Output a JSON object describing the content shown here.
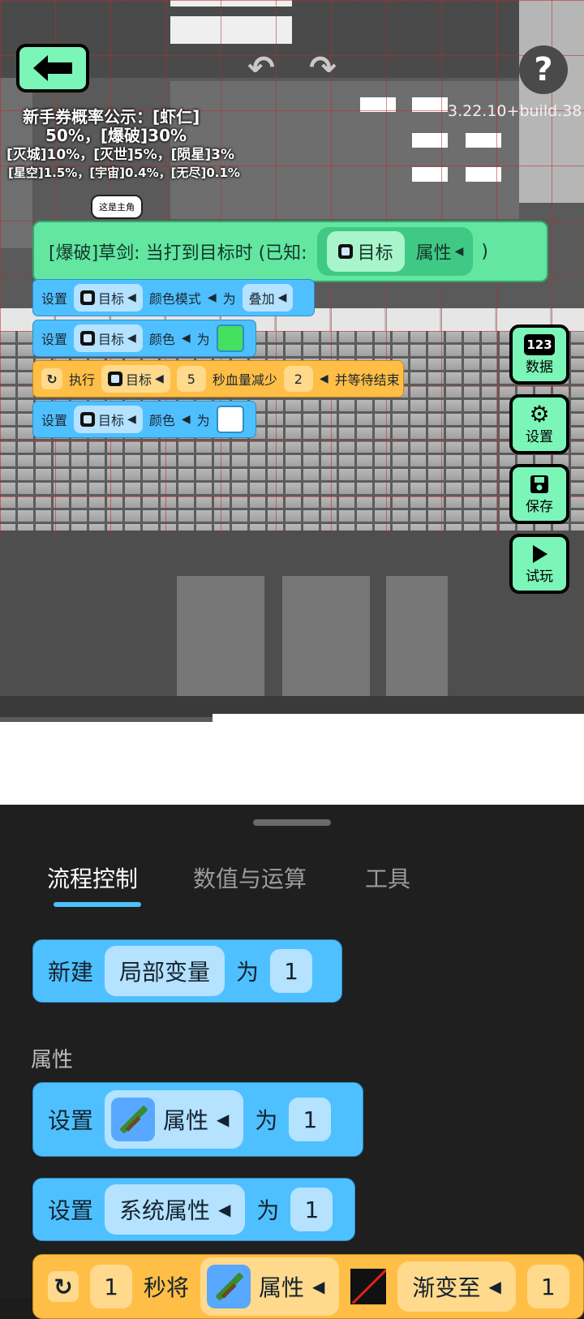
{
  "header": {
    "back_icon": "arrow-left-icon",
    "undo_icon": "undo-icon",
    "redo_icon": "redo-icon",
    "help_label": "?",
    "build": "3.22.10+build.38"
  },
  "probability": {
    "line1": "新手券概率公示：[虾仁]",
    "line2": "50%，[爆破]30%",
    "line3": "[灭城]10%，[灭世]5%，[陨星]3%",
    "line4": "[星空]1.5%，[宇宙]0.4%，[无尽]0.1%"
  },
  "bubble": "这是主角",
  "script": {
    "hat": {
      "text": "[爆破]草剑: 当打到目标时 (已知:",
      "target": "目标",
      "prop": "属性",
      "close": ")"
    },
    "line1": {
      "verb": "设置",
      "target": "目标",
      "prop": "颜色模式",
      "to": "为",
      "value": "叠加"
    },
    "line2": {
      "verb": "设置",
      "target": "目标",
      "prop": "颜色",
      "to": "为",
      "color": "#44e060"
    },
    "line3": {
      "verb": "执行",
      "target": "目标",
      "seconds": "5",
      "desc": "秒血量减少",
      "amount": "2",
      "tail": "并等待结束"
    },
    "line4": {
      "verb": "设置",
      "target": "目标",
      "prop": "颜色",
      "to": "为",
      "color": "#ffffff"
    }
  },
  "side_buttons": [
    {
      "icon": "123",
      "label": "数据"
    },
    {
      "icon": "gear-icon",
      "label": "设置"
    },
    {
      "icon": "save-icon",
      "label": "保存"
    },
    {
      "icon": "play-icon",
      "label": "试玩"
    }
  ],
  "drawer": {
    "tabs": [
      "流程控制",
      "数值与运算",
      "工具"
    ],
    "active_tab": 0,
    "new_var": {
      "verb": "新建",
      "name": "局部变量",
      "to": "为",
      "value": "1"
    },
    "section_label": "属性",
    "set_attr": {
      "verb": "设置",
      "prop": "属性",
      "to": "为",
      "value": "1"
    },
    "set_sys": {
      "verb": "设置",
      "prop": "系统属性",
      "to": "为",
      "value": "1"
    },
    "tween": {
      "sec": "1",
      "desc": "秒将",
      "prop": "属性",
      "mode": "渐变至",
      "value": "1"
    }
  },
  "colors": {
    "accent": "#7cf5b8",
    "block_blue": "#4fc0ff",
    "block_orange": "#ffbe46",
    "hat_green": "#62e6a0"
  }
}
